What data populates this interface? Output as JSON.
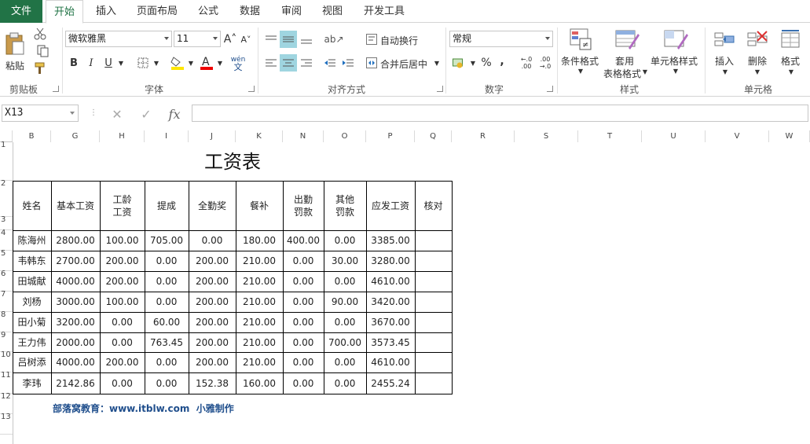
{
  "menu": {
    "file": "文件",
    "tabs": [
      "开始",
      "插入",
      "页面布局",
      "公式",
      "数据",
      "审阅",
      "视图",
      "开发工具"
    ]
  },
  "ribbon": {
    "clipboard": {
      "paste": "粘贴",
      "label": "剪贴板"
    },
    "font": {
      "name": "微软雅黑",
      "size": "11",
      "label": "字体",
      "bold": "B",
      "italic": "I",
      "underline": "U"
    },
    "align": {
      "wrap": "自动换行",
      "merge": "合并后居中",
      "label": "对齐方式"
    },
    "number": {
      "format": "常规",
      "percent": "%",
      "comma": ",",
      "label": "数字"
    },
    "styles": {
      "conditional": "条件格式",
      "table": "套用",
      "table2": "表格格式",
      "cell_styles": "单元格样式",
      "label": "样式"
    },
    "cells": {
      "insert": "插入",
      "delete": "删除",
      "format": "格式",
      "label": "单元格"
    }
  },
  "formula_bar": {
    "name_box": "X13",
    "fx": "fx",
    "value": ""
  },
  "columns": [
    "B",
    "G",
    "H",
    "I",
    "J",
    "K",
    "N",
    "O",
    "P",
    "Q",
    "R",
    "S",
    "T",
    "U",
    "V",
    "W"
  ],
  "rows": [
    "1",
    "2",
    "3",
    "4",
    "5",
    "6",
    "7",
    "8",
    "9",
    "10",
    "11",
    "12",
    "13"
  ],
  "sheet": {
    "title": "工资表",
    "headers": [
      "姓名",
      "基本工资",
      "工龄\n工资",
      "提成",
      "全勤奖",
      "餐补",
      "出勤\n罚款",
      "其他\n罚款",
      "应发工资",
      "核对"
    ],
    "data": [
      [
        "陈海州",
        "2800.00",
        "100.00",
        "705.00",
        "0.00",
        "180.00",
        "400.00",
        "0.00",
        "3385.00",
        ""
      ],
      [
        "韦韩东",
        "2700.00",
        "200.00",
        "0.00",
        "200.00",
        "210.00",
        "0.00",
        "30.00",
        "3280.00",
        ""
      ],
      [
        "田城献",
        "4000.00",
        "200.00",
        "0.00",
        "200.00",
        "210.00",
        "0.00",
        "0.00",
        "4610.00",
        ""
      ],
      [
        "刘杨",
        "3000.00",
        "100.00",
        "0.00",
        "200.00",
        "210.00",
        "0.00",
        "90.00",
        "3420.00",
        ""
      ],
      [
        "田小菊",
        "3200.00",
        "0.00",
        "60.00",
        "200.00",
        "210.00",
        "0.00",
        "0.00",
        "3670.00",
        ""
      ],
      [
        "王力伟",
        "2000.00",
        "0.00",
        "763.45",
        "200.00",
        "210.00",
        "0.00",
        "700.00",
        "3573.45",
        ""
      ],
      [
        "吕树添",
        "4000.00",
        "200.00",
        "0.00",
        "200.00",
        "210.00",
        "0.00",
        "0.00",
        "4610.00",
        ""
      ],
      [
        "李玮",
        "2142.86",
        "0.00",
        "0.00",
        "152.38",
        "160.00",
        "0.00",
        "0.00",
        "2455.24",
        ""
      ]
    ],
    "footer": "部落窝教育：www.itblw.com  小雅制作"
  },
  "colors": {
    "accent": "#217346",
    "footer": "#1f4e8c"
  }
}
